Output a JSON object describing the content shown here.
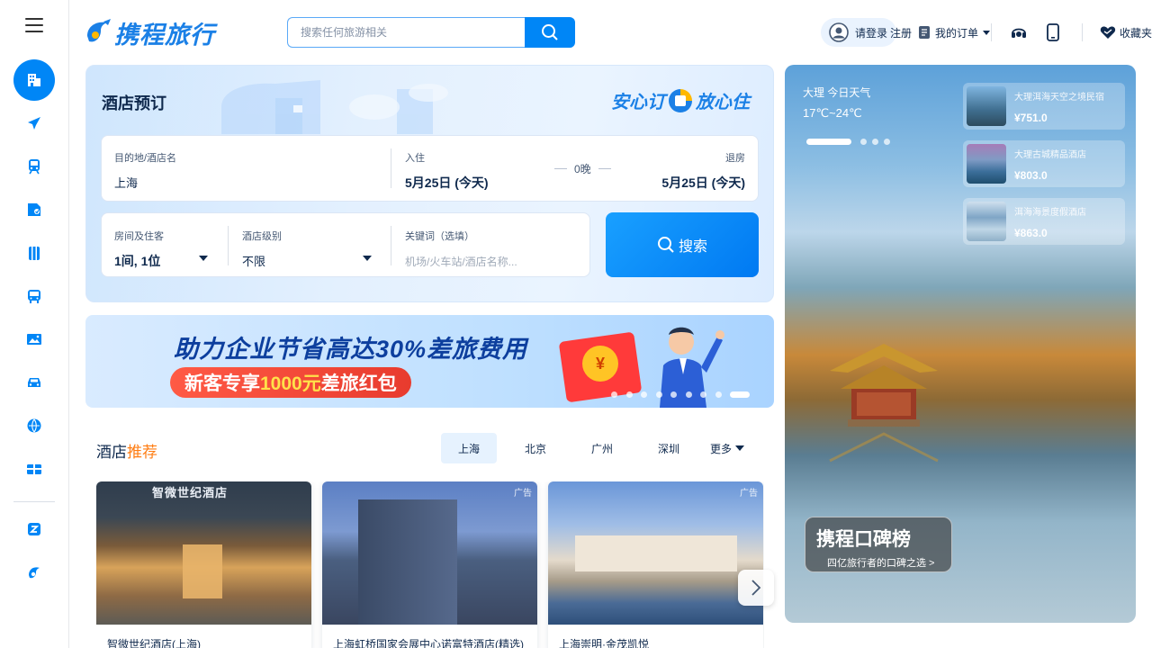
{
  "brand": {
    "name": "携程旅行",
    "accent": "#0086f6",
    "highlight": "#ff7d13"
  },
  "header": {
    "search_placeholder": "搜索任何旅游相关",
    "login_label": "请登录",
    "register_label": "注册",
    "orders_label": "我的订单",
    "favorites_label": "收藏夹",
    "icons": [
      "customer-service-icon",
      "mobile-icon",
      "favorites-heart-icon"
    ]
  },
  "rail": {
    "items": [
      {
        "name": "hotel",
        "icon": "hotel-icon",
        "active": true
      },
      {
        "name": "flight",
        "icon": "plane-icon"
      },
      {
        "name": "train",
        "icon": "train-icon"
      },
      {
        "name": "tickets",
        "icon": "attraction-ticket-icon"
      },
      {
        "name": "travel",
        "icon": "suitcase-icon"
      },
      {
        "name": "bus",
        "icon": "bus-icon"
      },
      {
        "name": "photo",
        "icon": "image-icon"
      },
      {
        "name": "car",
        "icon": "car-icon"
      },
      {
        "name": "global",
        "icon": "globe-plane-icon"
      },
      {
        "name": "gift-card",
        "icon": "gift-card-icon"
      }
    ],
    "bottom_items": [
      {
        "name": "business",
        "icon": "z-letter-icon"
      },
      {
        "name": "mascot",
        "icon": "dolphin-icon"
      }
    ]
  },
  "hotel_search": {
    "title": "酒店预订",
    "slogan_left": "安心订",
    "slogan_right": "放心住",
    "city_label": "目的地/酒店名",
    "city_value": "上海",
    "checkin_label": "入住",
    "checkin_value": "5月25日 (今天)",
    "nights_value": "0晚",
    "checkout_label": "退房",
    "checkout_value": "5月25日 (今天)",
    "rooms_label": "房间及住客",
    "rooms_value": "1间, 1位",
    "star_label": "酒店级别",
    "star_value": "不限",
    "keyword_label": "关键词（选填）",
    "keyword_placeholder": "机场/火车站/酒店名称...",
    "search_button": "搜索"
  },
  "banner": {
    "headline": "助力企业节省高达30%差旅费用",
    "sub_prefix": "新客专享",
    "sub_amount": "1000元",
    "sub_suffix": "差旅红包",
    "coin_symbol": "¥",
    "slide_count": 9,
    "active_slide": 9
  },
  "recommend": {
    "title_main": "酒店",
    "title_accent": "推荐",
    "tabs": [
      "上海",
      "北京",
      "广州",
      "深圳"
    ],
    "active_tab": 0,
    "more_label": "更多",
    "cards": [
      {
        "name": "智微世纪酒店(上海)",
        "tag": "广告",
        "sign": "智微世纪酒店"
      },
      {
        "name": "上海虹桥国家会展中心诺富特酒店(精选)",
        "tag": "广告"
      },
      {
        "name": "上海崇明·金茂凯悦",
        "tag": "广告"
      }
    ]
  },
  "promo": {
    "city_label": "大理 今日天气",
    "temperature": "17℃~24℃",
    "dots": 4,
    "active_dot": 1,
    "items": [
      {
        "name": "大理洱海天空之境民宿",
        "price": "¥751.0"
      },
      {
        "name": "大理古城精品酒店",
        "price": "¥803.0"
      },
      {
        "name": "洱海海景度假酒店",
        "price": "¥863.0"
      }
    ],
    "koubei_title": "携程口碑榜",
    "koubei_sub": "四亿旅行者的口碑之选 >"
  }
}
